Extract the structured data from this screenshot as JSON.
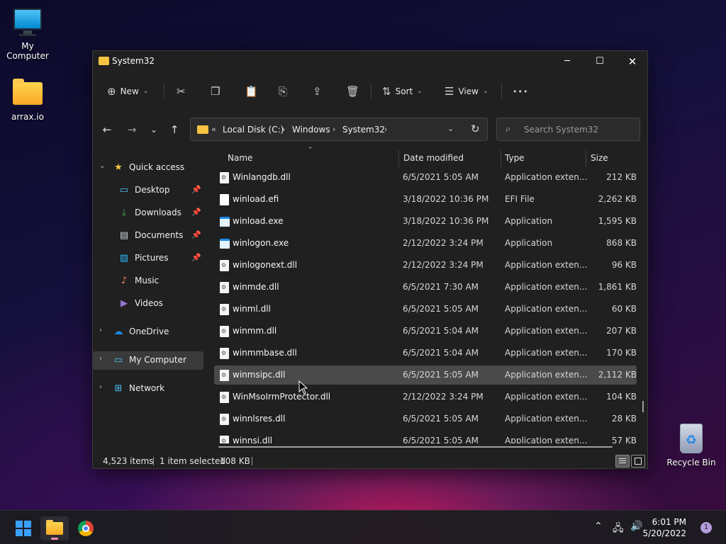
{
  "desktop": {
    "icons": [
      {
        "label": "My Computer"
      },
      {
        "label": "arrax.io"
      },
      {
        "label": "Recycle Bin"
      }
    ]
  },
  "window": {
    "title": "System32",
    "controls": {
      "minimize": "─",
      "maximize": "☐",
      "close": "✕"
    }
  },
  "toolbar": {
    "new_label": "New",
    "sort_label": "Sort",
    "view_label": "View",
    "more_label": "•••",
    "icons": [
      "cut-icon",
      "copy-icon",
      "paste-icon",
      "rename-icon",
      "share-icon",
      "delete-icon"
    ]
  },
  "address": {
    "overflow": "«",
    "parts": [
      "Local Disk (C:)",
      "Windows",
      "System32"
    ]
  },
  "search": {
    "placeholder": "Search System32"
  },
  "nav": {
    "quick_access": "Quick access",
    "items": [
      {
        "label": "Desktop"
      },
      {
        "label": "Downloads"
      },
      {
        "label": "Documents"
      },
      {
        "label": "Pictures"
      },
      {
        "label": "Music"
      },
      {
        "label": "Videos"
      }
    ],
    "onedrive": "OneDrive",
    "my_computer": "My Computer",
    "network": "Network"
  },
  "columns": {
    "name": "Name",
    "date": "Date modified",
    "type": "Type",
    "size": "Size"
  },
  "files": [
    {
      "name": "Winlangdb.dll",
      "date": "6/5/2021 5:05 AM",
      "type": "Application exten...",
      "size": "212 KB"
    },
    {
      "name": "winload.efi",
      "date": "3/18/2022 10:36 PM",
      "type": "EFI File",
      "size": "2,262 KB"
    },
    {
      "name": "winload.exe",
      "date": "3/18/2022 10:36 PM",
      "type": "Application",
      "size": "1,595 KB"
    },
    {
      "name": "winlogon.exe",
      "date": "2/12/2022 3:24 PM",
      "type": "Application",
      "size": "868 KB"
    },
    {
      "name": "winlogonext.dll",
      "date": "2/12/2022 3:24 PM",
      "type": "Application exten...",
      "size": "96 KB"
    },
    {
      "name": "winmde.dll",
      "date": "6/5/2021 7:30 AM",
      "type": "Application exten...",
      "size": "1,861 KB"
    },
    {
      "name": "winml.dll",
      "date": "6/5/2021 5:05 AM",
      "type": "Application exten...",
      "size": "60 KB"
    },
    {
      "name": "winmm.dll",
      "date": "6/5/2021 5:04 AM",
      "type": "Application exten...",
      "size": "207 KB"
    },
    {
      "name": "winmmbase.dll",
      "date": "6/5/2021 5:04 AM",
      "type": "Application exten...",
      "size": "170 KB"
    },
    {
      "name": "winmsipc.dll",
      "date": "6/5/2021 5:05 AM",
      "type": "Application exten...",
      "size": "2,112 KB"
    },
    {
      "name": "WinMsoIrmProtector.dll",
      "date": "2/12/2022 3:24 PM",
      "type": "Application exten...",
      "size": "104 KB"
    },
    {
      "name": "winnlsres.dll",
      "date": "6/5/2021 5:05 AM",
      "type": "Application exten...",
      "size": "28 KB"
    },
    {
      "name": "winnsi.dll",
      "date": "6/5/2021 5:05 AM",
      "type": "Application exten...",
      "size": "57 KB"
    }
  ],
  "status": {
    "items": "4,523 items",
    "selected": "1 item selected",
    "size": "108 KB"
  },
  "taskbar": {
    "time": "6:01 PM",
    "date": "5/20/2022",
    "notifications": "1"
  }
}
